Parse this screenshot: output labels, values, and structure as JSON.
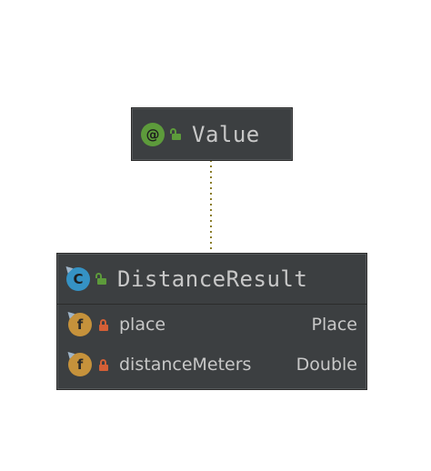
{
  "annotation": {
    "icon": "annotation-icon",
    "icon_text": "@",
    "visibility": "public",
    "name": "Value"
  },
  "class": {
    "icon": "class-icon",
    "icon_text": "C",
    "visibility": "public",
    "name": "DistanceResult",
    "fields": [
      {
        "icon": "field-icon",
        "icon_text": "f",
        "visibility": "private",
        "name": "place",
        "type": "Place"
      },
      {
        "icon": "field-icon",
        "icon_text": "f",
        "visibility": "private",
        "name": "distanceMeters",
        "type": "Double"
      }
    ]
  },
  "relation": {
    "type": "annotated-by",
    "style": "dotted"
  },
  "colors": {
    "node_bg": "#3c3f41",
    "text": "#c8c8c8",
    "annotation_icon": "#5d9b3b",
    "class_icon": "#3592c4",
    "field_icon": "#c6923b",
    "public_lock": "#5d9b3b",
    "private_lock": "#d35f36",
    "connector": "#8a7d2a"
  }
}
